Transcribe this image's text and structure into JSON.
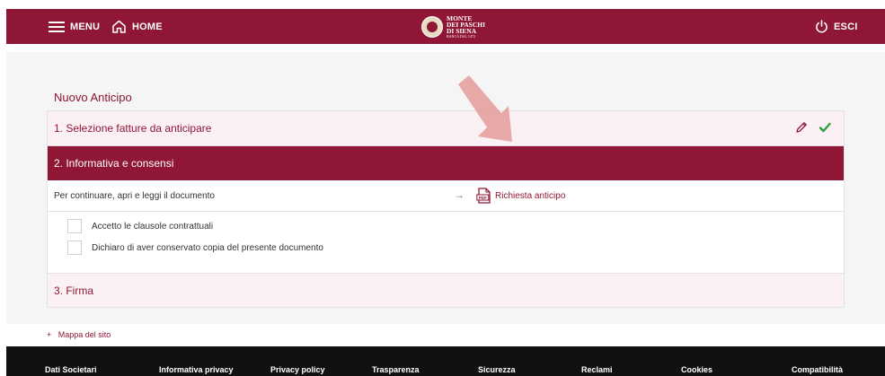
{
  "header": {
    "menu_label": "MENU",
    "home_label": "HOME",
    "logo": {
      "line1": "MONTE",
      "line2": "DEI PASCHI",
      "line3": "DI SIENA",
      "tagline": "BANCA DAL 1472"
    },
    "exit_label": "ESCI"
  },
  "page": {
    "title": "Nuovo Anticipo",
    "steps": [
      {
        "label": "1. Selezione fatture da anticipare"
      },
      {
        "label": "2. Informativa e consensi"
      },
      {
        "label": "3. Firma"
      }
    ],
    "document_row": {
      "instruction": "Per continuare, apri e leggi il documento",
      "arrow": "→",
      "link_label": "Richiesta anticipo",
      "icon": "pdf-icon"
    },
    "checkboxes": [
      {
        "label": "Accetto le clausole contrattuali",
        "checked": false
      },
      {
        "label": "Dichiaro di aver conservato copia del presente documento",
        "checked": false
      }
    ]
  },
  "sitemap": {
    "plus": "+",
    "label": "Mappa del sito"
  },
  "footer": {
    "links": [
      "Dati Societari",
      "Informativa privacy",
      "Privacy policy",
      "Trasparenza",
      "Sicurezza",
      "Reclami",
      "Cookies",
      "Compatibilità"
    ]
  },
  "colors": {
    "brand": "#8f1634",
    "step_bg": "#fbf1f4",
    "check_green": "#2e9e3e",
    "annotation": "#e6a0a0"
  }
}
